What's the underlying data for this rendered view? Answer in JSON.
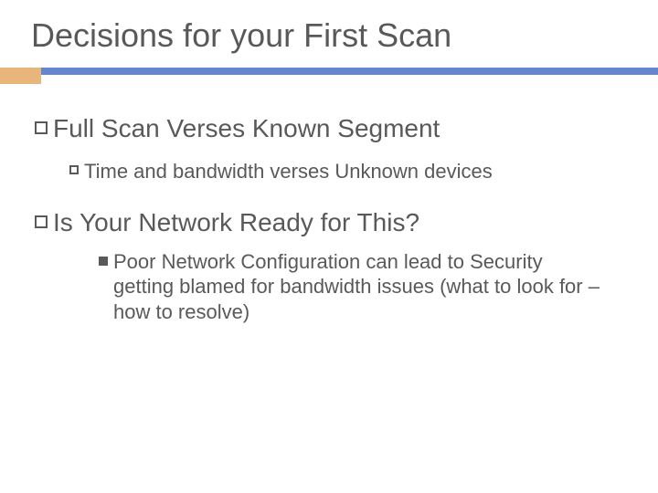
{
  "title": "Decisions for your First Scan",
  "items": {
    "l1a": "Full Scan Verses Known Segment",
    "l2a": "Time and bandwidth verses Unknown devices",
    "l1b": "Is Your Network Ready for This?",
    "l3a": "Poor Network Configuration can lead to Security getting blamed for bandwidth issues (what to look for – how to resolve)"
  }
}
